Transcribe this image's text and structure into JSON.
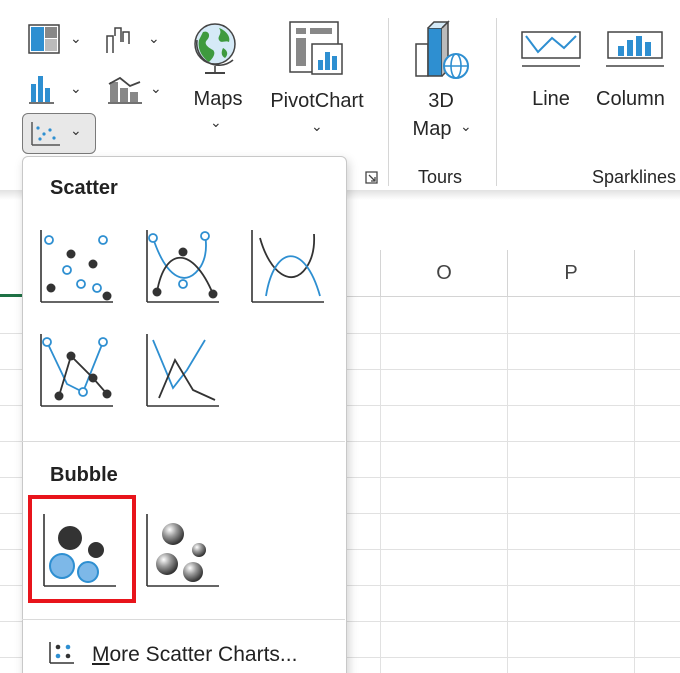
{
  "ribbon": {
    "maps_label": "Maps",
    "pivotchart_label": "PivotChart",
    "map3d_line1": "3D",
    "map3d_line2": "Map",
    "tours_label": "Tours",
    "line_label": "Line",
    "column_label": "Column",
    "sparklines_label": "Sparklines"
  },
  "sheet": {
    "columns": [
      "O",
      "P"
    ]
  },
  "menu": {
    "scatter_heading": "Scatter",
    "bubble_heading": "Bubble",
    "more_first_letter": "M",
    "more_rest": "ore Scatter Charts..."
  },
  "colors": {
    "accent_blue": "#2e8fd1",
    "highlight_red": "#e8141b",
    "dark_marker": "#333333",
    "excel_green": "#1e7145"
  }
}
